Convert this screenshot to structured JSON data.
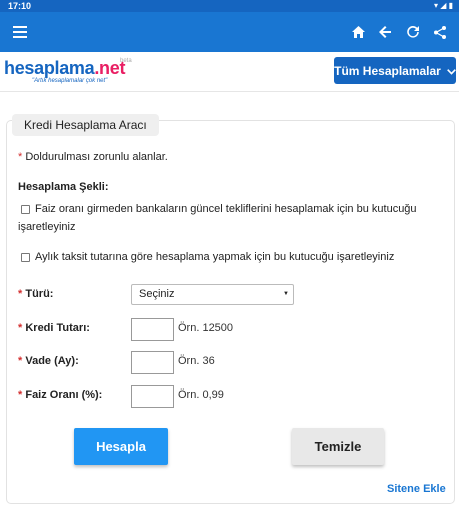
{
  "status_bar": {
    "time": "17:10",
    "icons": [
      "wifi-icon",
      "signal-icon",
      "battery-icon"
    ]
  },
  "app_bar": {
    "icons": [
      "menu-icon",
      "home-icon",
      "back-arrow-icon",
      "refresh-icon",
      "share-icon"
    ]
  },
  "site": {
    "logo_name": "hesaplama",
    "logo_tld": ".net",
    "logo_beta": "beta",
    "slogan": "\"Artık hesaplamalar çok net\"",
    "all_calcs_button": "Tüm Hesaplamalar"
  },
  "form": {
    "title": "Kredi Hesaplama Aracı",
    "required_asterisk": "*",
    "required_note": " Doldurulması zorunlu alanlar.",
    "method_heading": "Hesaplama Şekli:",
    "option1_line1": "Faiz oranı girmeden bankaların güncel tekliflerini hesaplamak için bu kutucuğu",
    "option1_line2": "işaretleyiniz",
    "option2": "Aylık taksit tutarına göre hesaplama yapmak için bu kutucuğu işaretleyiniz",
    "type_label": "Türü:",
    "type_selected": "Seçiniz",
    "amount_label": "Kredi Tutarı:",
    "amount_value": "",
    "amount_example": "Örn. 12500",
    "term_label": "Vade (Ay):",
    "term_value": "",
    "term_example": "Örn. 36",
    "rate_label": "Faiz Oranı (%):",
    "rate_value": "",
    "rate_example": "Örn. 0,99",
    "calculate_button": "Hesapla",
    "clear_button": "Temizle",
    "add_site_link": "Sitene Ekle"
  },
  "colors": {
    "status_bar": "#1565c0",
    "app_bar": "#1976d2",
    "primary_button": "#2196f3",
    "required": "#d32f2f",
    "logo_tld": "#e91e63"
  }
}
